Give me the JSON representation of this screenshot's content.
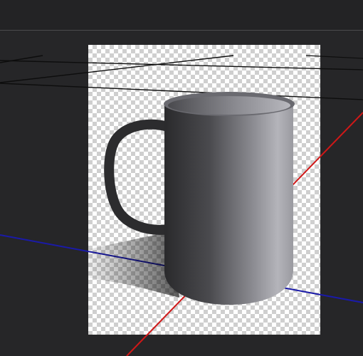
{
  "viewport": {
    "background": "#262628",
    "render_region": "transparent-checkerboard"
  },
  "scene": {
    "object": "mug",
    "object_color": "#5a5a5e",
    "axes": {
      "x_axis_color": "#d01818",
      "y_axis_color": "#1a1aa8"
    },
    "guide_line_color": "#111111"
  }
}
